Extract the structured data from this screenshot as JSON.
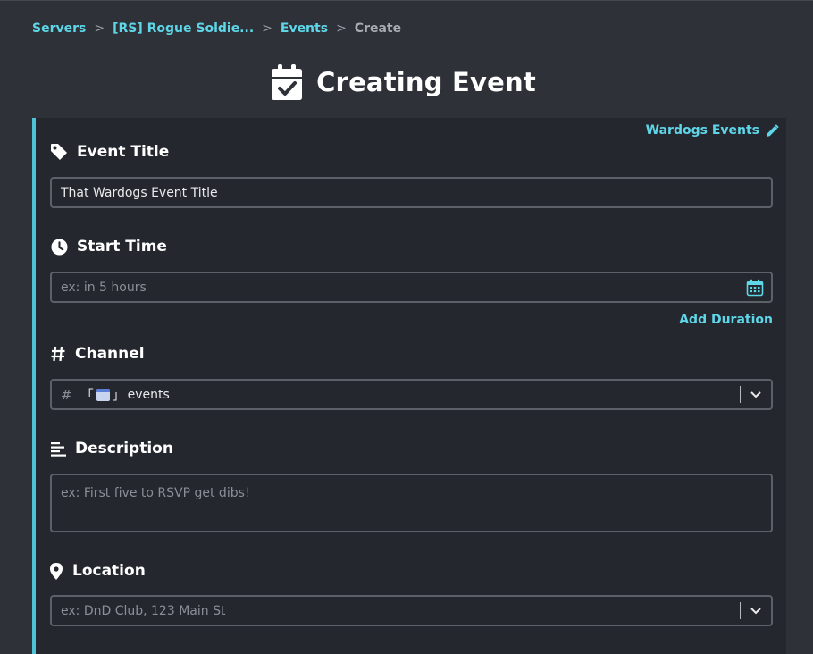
{
  "breadcrumb": {
    "items": [
      "Servers",
      "[RS] Rogue Soldie...",
      "Events"
    ],
    "current": "Create",
    "separator": ">"
  },
  "header": {
    "title": "Creating Event",
    "icon": "calendar-check-icon"
  },
  "template_link": {
    "label": "Wardogs Events",
    "icon": "pencil-icon"
  },
  "fields": {
    "event_title": {
      "label": "Event Title",
      "icon": "tag-icon",
      "value": "That Wardogs Event Title"
    },
    "start_time": {
      "label": "Start Time",
      "icon": "clock-icon",
      "placeholder": "ex: in 5 hours",
      "picker_icon": "calendar-icon",
      "add_duration": "Add Duration"
    },
    "channel": {
      "label": "Channel",
      "icon": "hash-icon",
      "prefix": "#",
      "bracket_open": "「",
      "bracket_close": "」",
      "value": "events",
      "emoji": "calendar-emoji"
    },
    "description": {
      "label": "Description",
      "icon": "align-left-icon",
      "placeholder": "ex: First five to RSVP get dibs!"
    },
    "location": {
      "label": "Location",
      "icon": "map-pin-icon",
      "placeholder": "ex: DnD Club, 123 Main St"
    }
  },
  "colors": {
    "accent": "#5ed6e8",
    "panel_border": "#4fc3d6",
    "background": "#2e3138",
    "panel": "#24272e"
  }
}
